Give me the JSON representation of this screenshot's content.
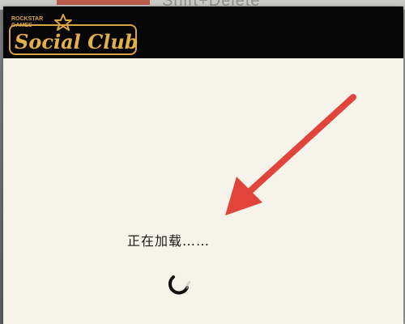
{
  "background": {
    "title_fragment": "Shift+Delete"
  },
  "header": {
    "logo_small_line1": "ROCKSTAR",
    "logo_small_line2": "GAMES",
    "logo_main": "Social Club",
    "logo_icon": "star-icon"
  },
  "main": {
    "loading_text": "正在加载……",
    "spinner_icon": "loading-spinner-icon",
    "annotation_icon": "red-arrow-icon"
  },
  "colors": {
    "header_bg": "#060606",
    "content_bg": "#f6f4ea",
    "logo_gold": "#d9a441",
    "arrow_red": "#e0443a"
  }
}
